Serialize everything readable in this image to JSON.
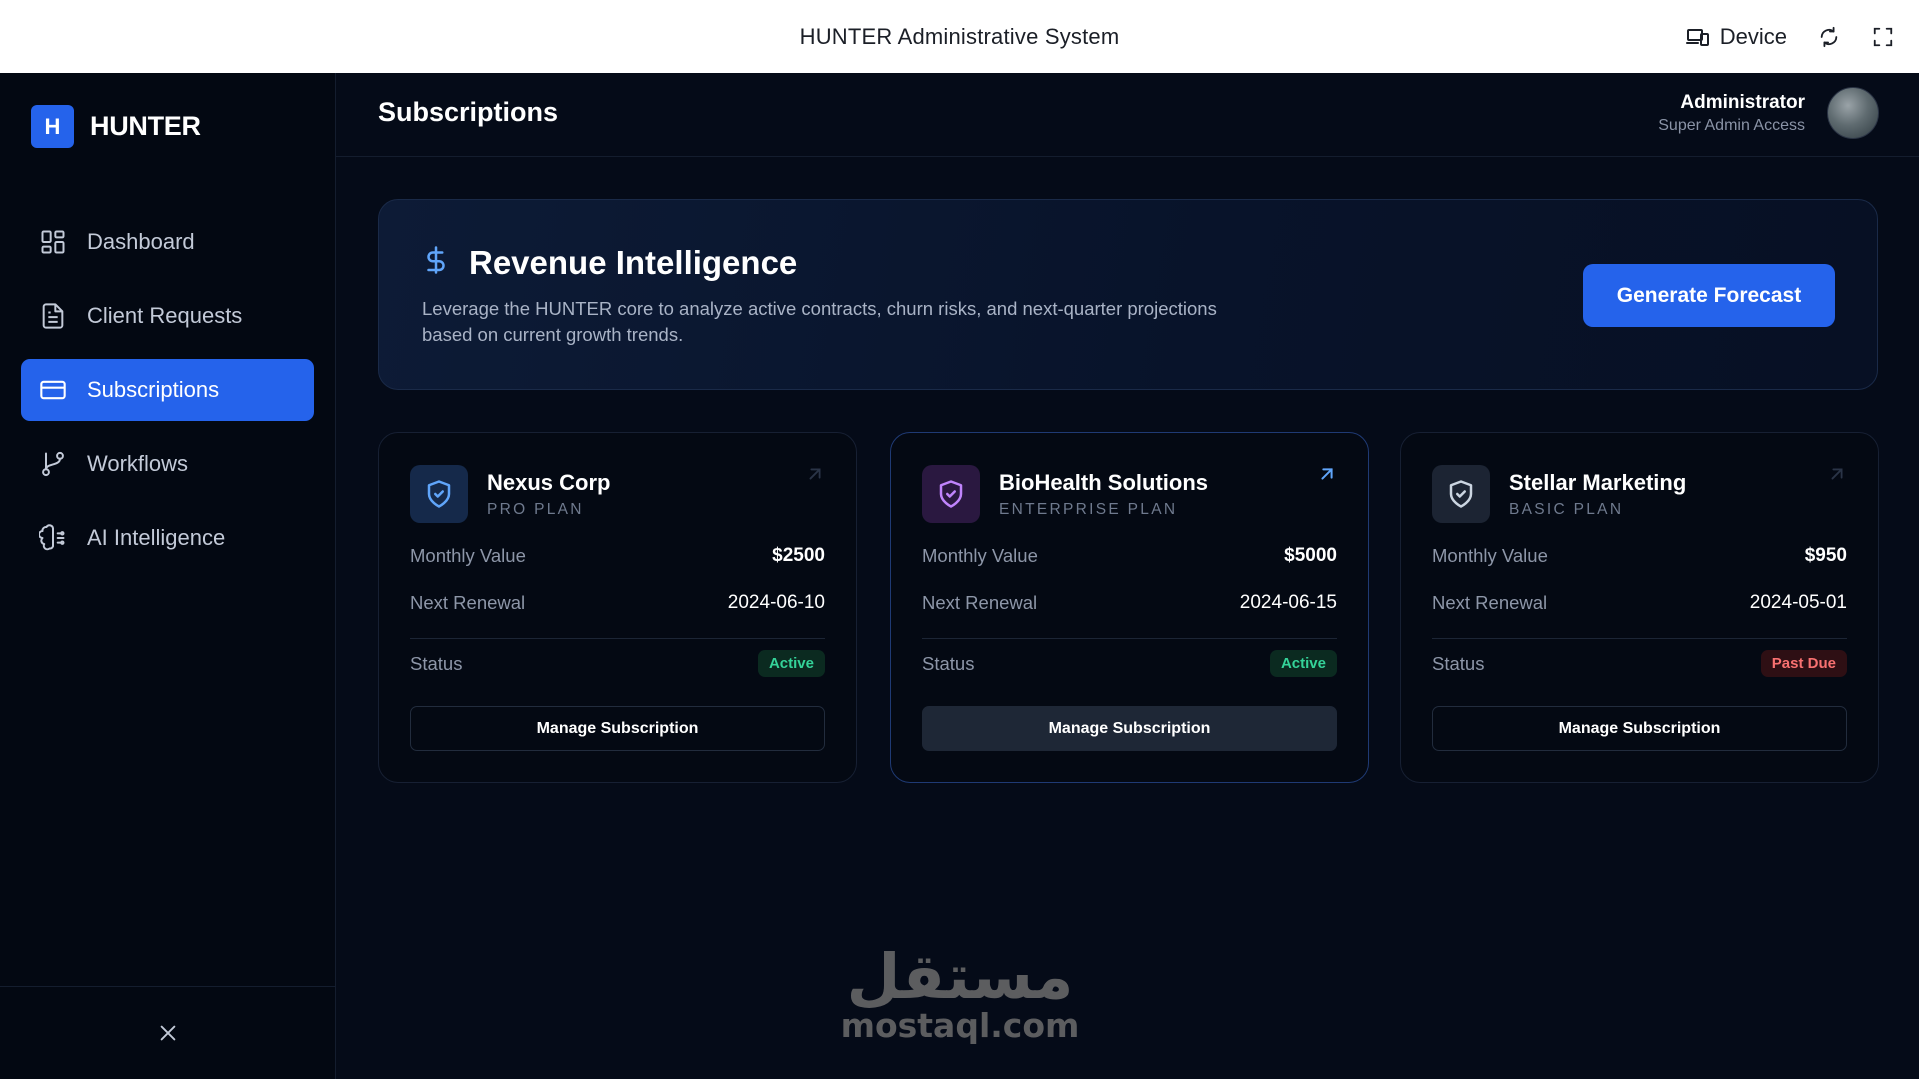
{
  "window": {
    "title": "HUNTER Administrative System",
    "device_label": "Device"
  },
  "sidebar": {
    "brand_mark": "H",
    "brand_name": "HUNTER",
    "items": [
      {
        "label": "Dashboard",
        "icon": "dashboard-grid-icon",
        "active": false
      },
      {
        "label": "Client Requests",
        "icon": "document-icon",
        "active": false
      },
      {
        "label": "Subscriptions",
        "icon": "credit-card-icon",
        "active": true
      },
      {
        "label": "Workflows",
        "icon": "git-branch-icon",
        "active": false
      },
      {
        "label": "AI Intelligence",
        "icon": "brain-icon",
        "active": false
      }
    ]
  },
  "header": {
    "title": "Subscriptions",
    "user_name": "Administrator",
    "user_role": "Super Admin Access"
  },
  "banner": {
    "title": "Revenue Intelligence",
    "description": "Leverage the HUNTER core to analyze active contracts, churn risks, and next-quarter projections based on current growth trends.",
    "button_label": "Generate Forecast"
  },
  "cards": [
    {
      "name": "Nexus Corp",
      "plan": "PRO PLAN",
      "monthly_label": "Monthly Value",
      "monthly_value": "$2500",
      "renewal_label": "Next Renewal",
      "renewal_date": "2024-06-10",
      "status_label": "Status",
      "status": "Active",
      "button_label": "Manage Subscription",
      "shield_color": "#60a5fa"
    },
    {
      "name": "BioHealth Solutions",
      "plan": "ENTERPRISE PLAN",
      "monthly_label": "Monthly Value",
      "monthly_value": "$5000",
      "renewal_label": "Next Renewal",
      "renewal_date": "2024-06-15",
      "status_label": "Status",
      "status": "Active",
      "button_label": "Manage Subscription",
      "shield_color": "#c084fc"
    },
    {
      "name": "Stellar Marketing",
      "plan": "BASIC PLAN",
      "monthly_label": "Monthly Value",
      "monthly_value": "$950",
      "renewal_label": "Next Renewal",
      "renewal_date": "2024-05-01",
      "status_label": "Status",
      "status": "Past Due",
      "button_label": "Manage Subscription",
      "shield_color": "#cbd5e1"
    }
  ],
  "watermark": {
    "logo_text": "مستقل",
    "text": "mostaql.com"
  },
  "colors": {
    "accent": "#2563eb",
    "background": "#050b18",
    "active_badge": "#34d399",
    "past_due_badge": "#f87171"
  }
}
